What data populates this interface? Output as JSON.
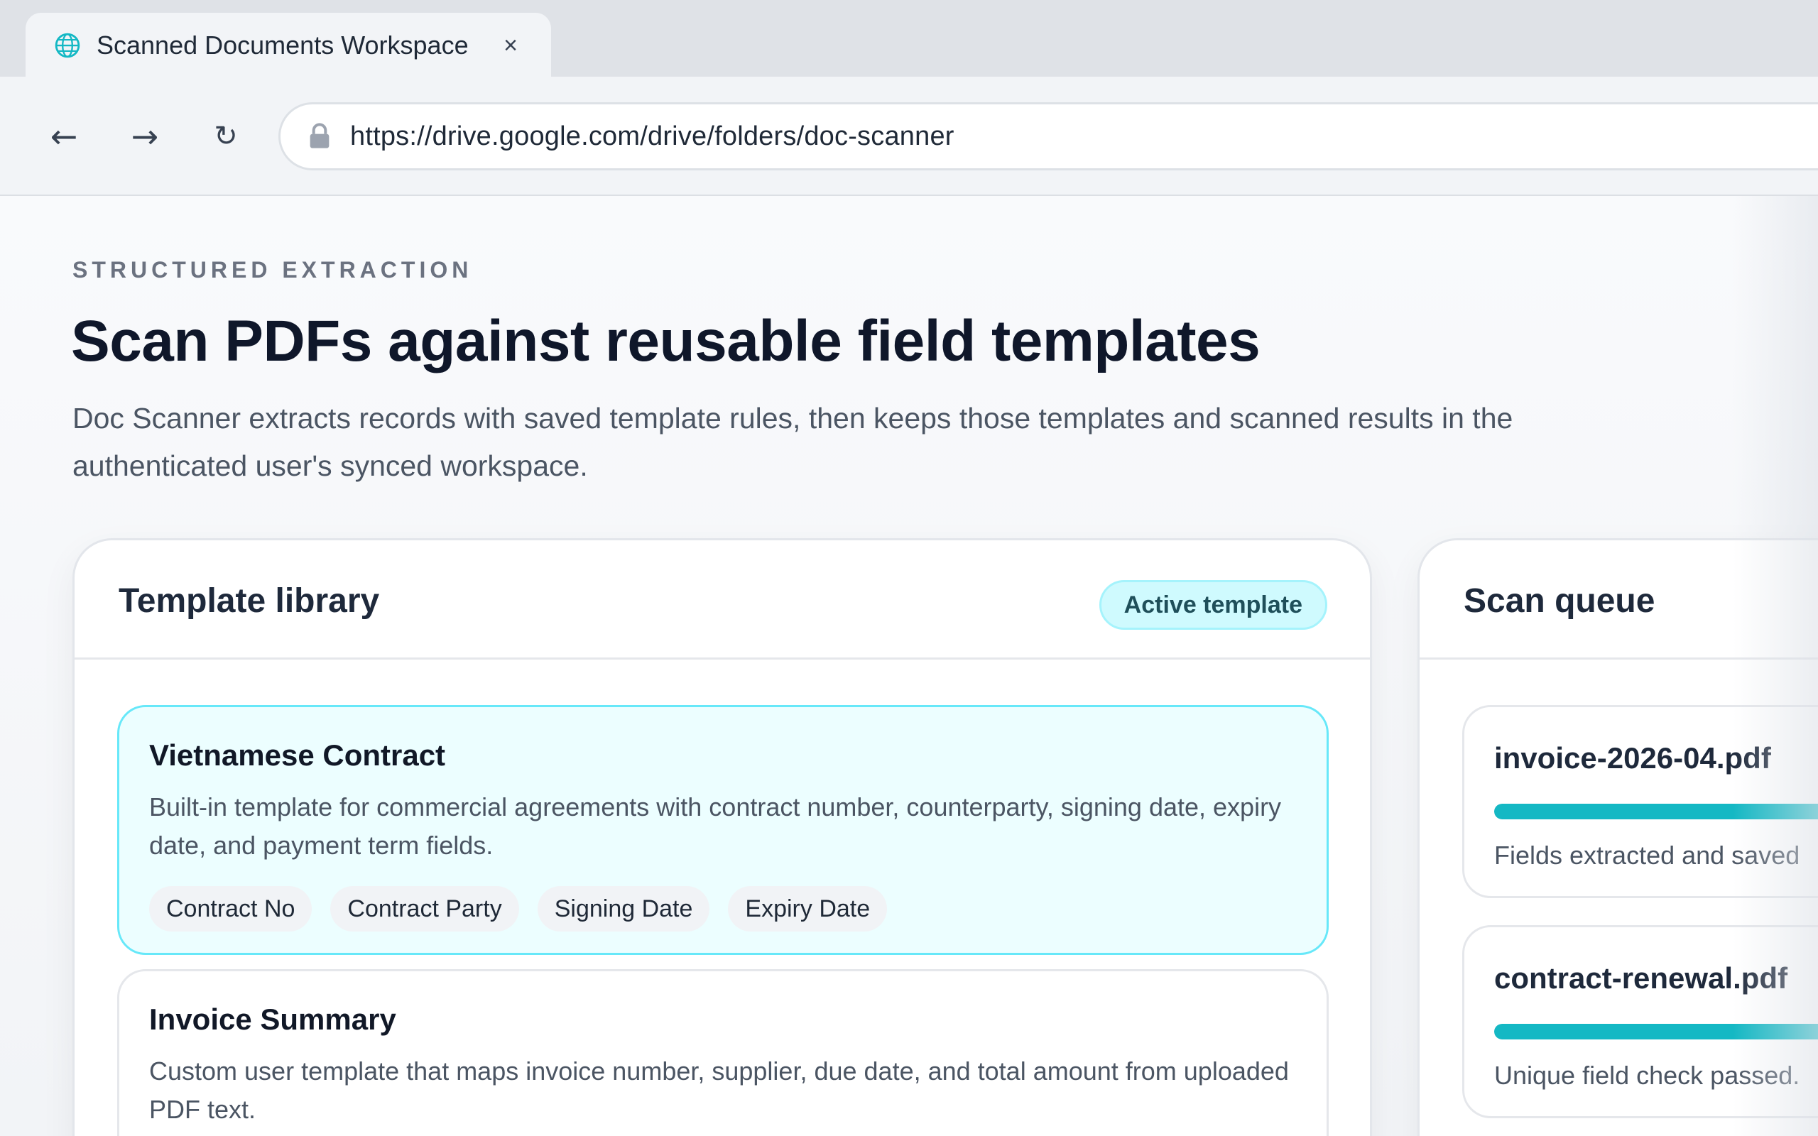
{
  "browser": {
    "tab": {
      "title": "Scanned Documents Workspace",
      "close_glyph": "×",
      "icon": "globe-icon"
    },
    "nav": {
      "back_glyph": "←",
      "forward_glyph": "→",
      "reload_glyph": "↻"
    },
    "address": {
      "url": "https://drive.google.com/drive/folders/doc-scanner",
      "icon": "lock-icon"
    }
  },
  "hero": {
    "eyebrow": "STRUCTURED EXTRACTION",
    "title": "Scan PDFs against reusable field templates",
    "description": "Doc Scanner extracts records with saved template rules, then keeps those templates and scanned results in the authenticated user's synced workspace."
  },
  "template_library": {
    "title": "Template library",
    "badge": "Active template",
    "templates": [
      {
        "name": "Vietnamese Contract",
        "description": "Built-in template for commercial agreements with contract number, counterparty, signing date, expiry date, and payment term fields.",
        "fields": [
          "Contract No",
          "Contract Party",
          "Signing Date",
          "Expiry Date"
        ],
        "active": true
      },
      {
        "name": "Invoice Summary",
        "description": "Custom user template that maps invoice number, supplier, due date, and total amount from uploaded PDF text.",
        "fields": [],
        "active": false
      }
    ]
  },
  "scan_queue": {
    "title": "Scan queue",
    "items": [
      {
        "file": "invoice-2026-04.pdf",
        "progress": 1.0,
        "status": "Fields extracted and saved"
      },
      {
        "file": "contract-renewal.pdf",
        "progress": 1.0,
        "status": "Unique field check passed."
      }
    ]
  },
  "colors": {
    "accent": "#14b8c4",
    "active_card_bg": "#ecfeff",
    "active_card_border": "#67e8f9",
    "badge_bg": "#cffafe"
  }
}
